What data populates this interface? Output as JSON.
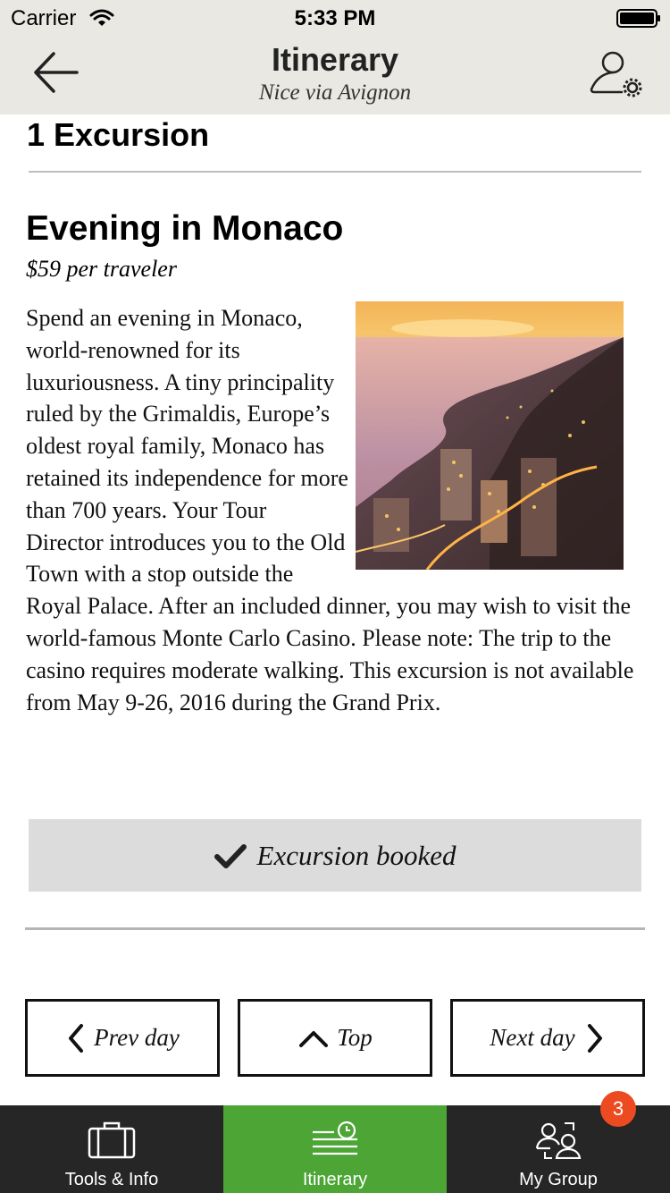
{
  "status_bar": {
    "carrier": "Carrier",
    "time": "5:33 PM"
  },
  "header": {
    "title": "Itinerary",
    "subtitle": "Nice via Avignon"
  },
  "section": {
    "heading": "1 Excursion"
  },
  "excursion": {
    "title": "Evening in Monaco",
    "price": "$59 per traveler",
    "description": "Spend an evening in Monaco, world-renowned for its luxuriousness. A tiny principality ruled by the Grimaldis, Europe’s oldest royal family, Monaco has retained its independence for more than 700 years. Your Tour Director introduces you to the Old Town with a stop outside the Royal Palace. After an included dinner, you may wish to visit the world-famous Monte Carlo Casino. Please note: The trip to the casino requires moderate walking. This excursion is not available from May 9-26, 2016 during the Grand Prix.",
    "status_label": "Excursion booked"
  },
  "day_nav": {
    "prev_label": "Prev day",
    "top_label": "Top",
    "next_label": "Next day"
  },
  "tab_bar": {
    "tabs": [
      {
        "label": "Tools & Info",
        "icon": "suitcase-icon",
        "active": false
      },
      {
        "label": "Itinerary",
        "icon": "itinerary-clock-icon",
        "active": true
      },
      {
        "label": "My Group",
        "icon": "group-icon",
        "active": false
      }
    ],
    "group_badge": "3"
  },
  "colors": {
    "header_bg": "#e9e8e2",
    "tab_bar_bg": "#262626",
    "tab_active_bg": "#4ca535",
    "badge_bg": "#ec4b22",
    "booked_bg": "#dcdcdc"
  }
}
